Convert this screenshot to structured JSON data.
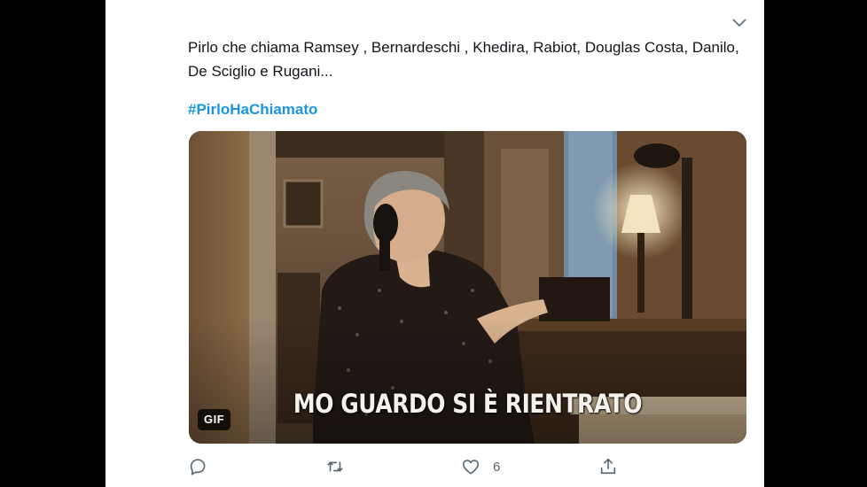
{
  "tweet": {
    "text": "Pirlo che chiama Ramsey , Bernardeschi , Khedira, Rabiot, Douglas Costa, Danilo, De Sciglio e Rugani...",
    "hashtag": "#PirloHaChiamato"
  },
  "media": {
    "type_badge": "GIF",
    "caption": "MO GUARDO SI È RIENTRATO"
  },
  "actions": {
    "reply": {
      "icon": "reply-icon"
    },
    "retweet": {
      "icon": "retweet-icon"
    },
    "like": {
      "icon": "heart-icon",
      "count": "6"
    },
    "share": {
      "icon": "share-icon"
    }
  },
  "colors": {
    "link": "#1b95e0",
    "text": "#0f1419",
    "icon": "#536471",
    "background": "#000000",
    "card": "#ffffff"
  }
}
